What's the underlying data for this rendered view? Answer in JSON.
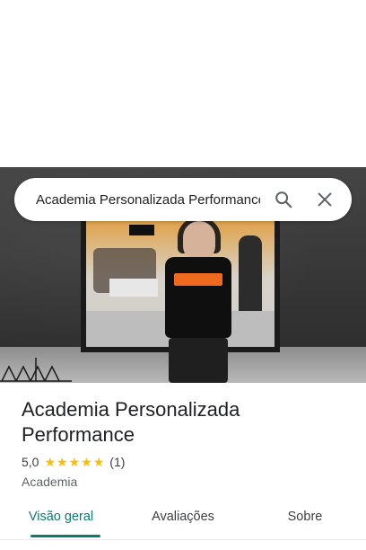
{
  "search": {
    "query": "Academia Personalizada Performance"
  },
  "place": {
    "title_line1": "Academia Personalizada",
    "title_line2": "Performance",
    "rating": "5,0",
    "review_count": "(1)",
    "stars": 5,
    "category": "Academia"
  },
  "tabs": [
    {
      "label": "Visão geral",
      "active": true
    },
    {
      "label": "Avaliações",
      "active": false
    },
    {
      "label": "Sobre",
      "active": false
    }
  ],
  "colors": {
    "accent": "#0b7a71",
    "star": "#fbbc04"
  },
  "icons": {
    "search": "search-icon",
    "close": "close-icon",
    "star": "star-icon"
  }
}
